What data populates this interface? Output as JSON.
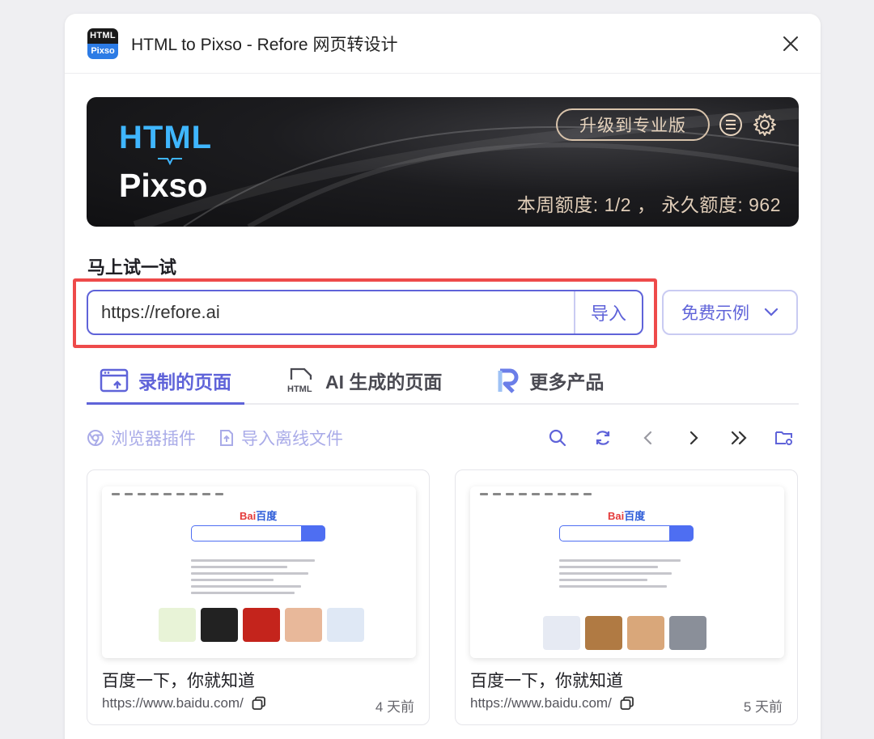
{
  "window": {
    "logo_top": "HTML",
    "logo_bottom": "Pixso",
    "title": "HTML to Pixso - Refore 网页转设计"
  },
  "banner": {
    "brand_html": "HTML",
    "brand_pixso": "Pixso",
    "upgrade_label": "升级到专业版",
    "quota_text": "本周额度: 1/2 ， 永久额度: 962"
  },
  "try": {
    "title": "马上试一试",
    "url_value": "https://refore.ai",
    "import_label": "导入",
    "examples_label": "免费示例"
  },
  "tabs": [
    {
      "label": "录制的页面"
    },
    {
      "label": "AI 生成的页面"
    },
    {
      "label": "更多产品"
    }
  ],
  "toolbar": {
    "browser_plugin": "浏览器插件",
    "import_offline": "导入离线文件"
  },
  "cards": [
    {
      "title": "百度一下，你就知道",
      "url": "https://www.baidu.com/",
      "time": "4 天前",
      "logo_a": "Bai",
      "logo_b": "百度"
    },
    {
      "title": "百度一下，你就知道",
      "url": "https://www.baidu.com/",
      "time": "5 天前",
      "logo_a": "Bai",
      "logo_b": "百度"
    }
  ],
  "colors": {
    "accent": "#5f63d9",
    "highlight": "#ee4a4a",
    "banner_gold": "#e0cdb8",
    "brand_blue": "#3fb6ff"
  }
}
